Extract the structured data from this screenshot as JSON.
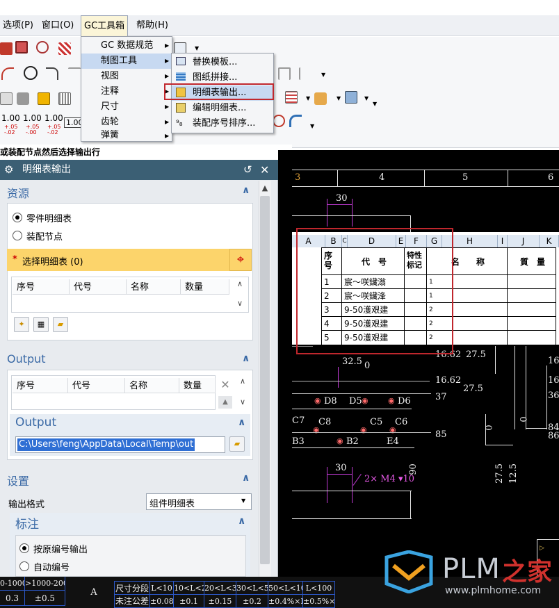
{
  "menubar": {
    "items": [
      "选项(P)",
      "窗口(O)",
      "GC工具箱",
      "帮助(H)"
    ]
  },
  "gc_menu": {
    "items": [
      "GC 数据规范",
      "制图工具",
      "视图",
      "注释",
      "尺寸",
      "齿轮",
      "弹簧"
    ]
  },
  "drafting_menu": {
    "items": [
      "替换模板...",
      "图纸拼接...",
      "明细表输出...",
      "编辑明细表...",
      "装配序号排序..."
    ]
  },
  "toolbar": {
    "tolerance_labels": [
      "1.00",
      "1.00",
      "1.00",
      "1.00"
    ],
    "tol_plus": [
      "+.05",
      "+.05",
      "+.05"
    ],
    "tol_minus": [
      "-.02",
      "-.00",
      "-.02"
    ]
  },
  "status": {
    "text": "或装配节点然后选择输出行"
  },
  "dialog": {
    "title": "明细表输出",
    "source": {
      "header": "资源",
      "opt_parts": "零件明细表",
      "opt_assembly": "装配节点",
      "select_label": "选择明细表 (0)",
      "required_mark": "*",
      "columns": [
        "序号",
        "代号",
        "名称",
        "数量"
      ]
    },
    "output": {
      "header": "Output",
      "columns": [
        "序号",
        "代号",
        "名称",
        "数量"
      ],
      "sub_header": "Output",
      "path": "C:\\Users\\feng\\AppData\\Local\\Temp\\out"
    },
    "settings": {
      "header": "设置",
      "format_label": "输出格式",
      "format_value": "组件明细表"
    },
    "annotation": {
      "header": "标注",
      "opt_original": "按原编号输出",
      "opt_auto": "自动编号"
    }
  },
  "cad": {
    "frame_numbers": [
      "3",
      "4",
      "5",
      "6"
    ],
    "dims": [
      "30",
      "30",
      "2× M4 ▾10",
      "27.5",
      "16.62",
      "16.62",
      "37",
      "85",
      "90",
      "27.5",
      "12.5",
      "32.5",
      "0",
      "A1",
      "0",
      "27.5",
      "16.",
      "36",
      "84",
      "86",
      "0",
      "16."
    ],
    "hole_labels": [
      "D8",
      "D5",
      "D6",
      "C7",
      "C8",
      "C5",
      "C6",
      "B3",
      "B2",
      "E4"
    ]
  },
  "excel": {
    "col_letters": [
      "A",
      "B",
      "C",
      "D",
      "E",
      "F",
      "G",
      "H",
      "I",
      "J",
      "K"
    ],
    "headers": {
      "seq": "序\n号",
      "code": "代　号",
      "special": "特性\n标记",
      "name": "名　　称",
      "qty": "質　量"
    },
    "rows": [
      {
        "seq": "1",
        "code": "宸～咲鑶滃",
        "g": "1"
      },
      {
        "seq": "2",
        "code": "宸～咲鑶浲",
        "g": "1"
      },
      {
        "seq": "3",
        "code": "9-50濩艰建",
        "g": "2"
      },
      {
        "seq": "4",
        "code": "9-50濩艰建",
        "g": "2"
      },
      {
        "seq": "5",
        "code": "9-50濩艰建",
        "g": "2"
      }
    ]
  },
  "bottom": {
    "left_cells": [
      "0-1000",
      ">1000-2000",
      "0.3",
      "±0.5"
    ],
    "label_a": "A",
    "row1": [
      "尺寸分段",
      "L<10",
      "10<L<20",
      "20<L<30",
      "30<L<50",
      "50<L<100",
      "L<100"
    ],
    "row2": [
      "未注公差",
      "±0.08",
      "±0.1",
      "±0.15",
      "±0.2",
      "±0.4%×L",
      "±0.5%×L"
    ]
  },
  "watermark": {
    "brand": "PLM",
    "brand_cn": "之家",
    "url": "www.plmhome.com"
  },
  "colors": {
    "title_bar": "#3b5f74",
    "section_header": "#3b6aa6",
    "highlight_row": "#fcd46b",
    "menu_highlight": "#c7d9f1",
    "selection_box": "#c0272d"
  }
}
